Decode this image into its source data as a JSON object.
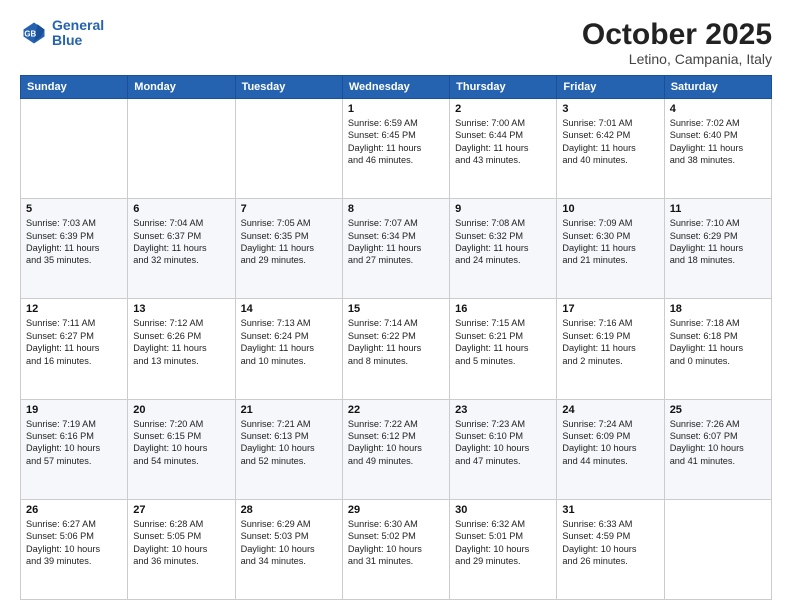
{
  "header": {
    "logo_line1": "General",
    "logo_line2": "Blue",
    "month": "October 2025",
    "location": "Letino, Campania, Italy"
  },
  "days_of_week": [
    "Sunday",
    "Monday",
    "Tuesday",
    "Wednesday",
    "Thursday",
    "Friday",
    "Saturday"
  ],
  "weeks": [
    [
      {
        "num": "",
        "info": ""
      },
      {
        "num": "",
        "info": ""
      },
      {
        "num": "",
        "info": ""
      },
      {
        "num": "1",
        "info": "Sunrise: 6:59 AM\nSunset: 6:45 PM\nDaylight: 11 hours\nand 46 minutes."
      },
      {
        "num": "2",
        "info": "Sunrise: 7:00 AM\nSunset: 6:44 PM\nDaylight: 11 hours\nand 43 minutes."
      },
      {
        "num": "3",
        "info": "Sunrise: 7:01 AM\nSunset: 6:42 PM\nDaylight: 11 hours\nand 40 minutes."
      },
      {
        "num": "4",
        "info": "Sunrise: 7:02 AM\nSunset: 6:40 PM\nDaylight: 11 hours\nand 38 minutes."
      }
    ],
    [
      {
        "num": "5",
        "info": "Sunrise: 7:03 AM\nSunset: 6:39 PM\nDaylight: 11 hours\nand 35 minutes."
      },
      {
        "num": "6",
        "info": "Sunrise: 7:04 AM\nSunset: 6:37 PM\nDaylight: 11 hours\nand 32 minutes."
      },
      {
        "num": "7",
        "info": "Sunrise: 7:05 AM\nSunset: 6:35 PM\nDaylight: 11 hours\nand 29 minutes."
      },
      {
        "num": "8",
        "info": "Sunrise: 7:07 AM\nSunset: 6:34 PM\nDaylight: 11 hours\nand 27 minutes."
      },
      {
        "num": "9",
        "info": "Sunrise: 7:08 AM\nSunset: 6:32 PM\nDaylight: 11 hours\nand 24 minutes."
      },
      {
        "num": "10",
        "info": "Sunrise: 7:09 AM\nSunset: 6:30 PM\nDaylight: 11 hours\nand 21 minutes."
      },
      {
        "num": "11",
        "info": "Sunrise: 7:10 AM\nSunset: 6:29 PM\nDaylight: 11 hours\nand 18 minutes."
      }
    ],
    [
      {
        "num": "12",
        "info": "Sunrise: 7:11 AM\nSunset: 6:27 PM\nDaylight: 11 hours\nand 16 minutes."
      },
      {
        "num": "13",
        "info": "Sunrise: 7:12 AM\nSunset: 6:26 PM\nDaylight: 11 hours\nand 13 minutes."
      },
      {
        "num": "14",
        "info": "Sunrise: 7:13 AM\nSunset: 6:24 PM\nDaylight: 11 hours\nand 10 minutes."
      },
      {
        "num": "15",
        "info": "Sunrise: 7:14 AM\nSunset: 6:22 PM\nDaylight: 11 hours\nand 8 minutes."
      },
      {
        "num": "16",
        "info": "Sunrise: 7:15 AM\nSunset: 6:21 PM\nDaylight: 11 hours\nand 5 minutes."
      },
      {
        "num": "17",
        "info": "Sunrise: 7:16 AM\nSunset: 6:19 PM\nDaylight: 11 hours\nand 2 minutes."
      },
      {
        "num": "18",
        "info": "Sunrise: 7:18 AM\nSunset: 6:18 PM\nDaylight: 11 hours\nand 0 minutes."
      }
    ],
    [
      {
        "num": "19",
        "info": "Sunrise: 7:19 AM\nSunset: 6:16 PM\nDaylight: 10 hours\nand 57 minutes."
      },
      {
        "num": "20",
        "info": "Sunrise: 7:20 AM\nSunset: 6:15 PM\nDaylight: 10 hours\nand 54 minutes."
      },
      {
        "num": "21",
        "info": "Sunrise: 7:21 AM\nSunset: 6:13 PM\nDaylight: 10 hours\nand 52 minutes."
      },
      {
        "num": "22",
        "info": "Sunrise: 7:22 AM\nSunset: 6:12 PM\nDaylight: 10 hours\nand 49 minutes."
      },
      {
        "num": "23",
        "info": "Sunrise: 7:23 AM\nSunset: 6:10 PM\nDaylight: 10 hours\nand 47 minutes."
      },
      {
        "num": "24",
        "info": "Sunrise: 7:24 AM\nSunset: 6:09 PM\nDaylight: 10 hours\nand 44 minutes."
      },
      {
        "num": "25",
        "info": "Sunrise: 7:26 AM\nSunset: 6:07 PM\nDaylight: 10 hours\nand 41 minutes."
      }
    ],
    [
      {
        "num": "26",
        "info": "Sunrise: 6:27 AM\nSunset: 5:06 PM\nDaylight: 10 hours\nand 39 minutes."
      },
      {
        "num": "27",
        "info": "Sunrise: 6:28 AM\nSunset: 5:05 PM\nDaylight: 10 hours\nand 36 minutes."
      },
      {
        "num": "28",
        "info": "Sunrise: 6:29 AM\nSunset: 5:03 PM\nDaylight: 10 hours\nand 34 minutes."
      },
      {
        "num": "29",
        "info": "Sunrise: 6:30 AM\nSunset: 5:02 PM\nDaylight: 10 hours\nand 31 minutes."
      },
      {
        "num": "30",
        "info": "Sunrise: 6:32 AM\nSunset: 5:01 PM\nDaylight: 10 hours\nand 29 minutes."
      },
      {
        "num": "31",
        "info": "Sunrise: 6:33 AM\nSunset: 4:59 PM\nDaylight: 10 hours\nand 26 minutes."
      },
      {
        "num": "",
        "info": ""
      }
    ]
  ]
}
